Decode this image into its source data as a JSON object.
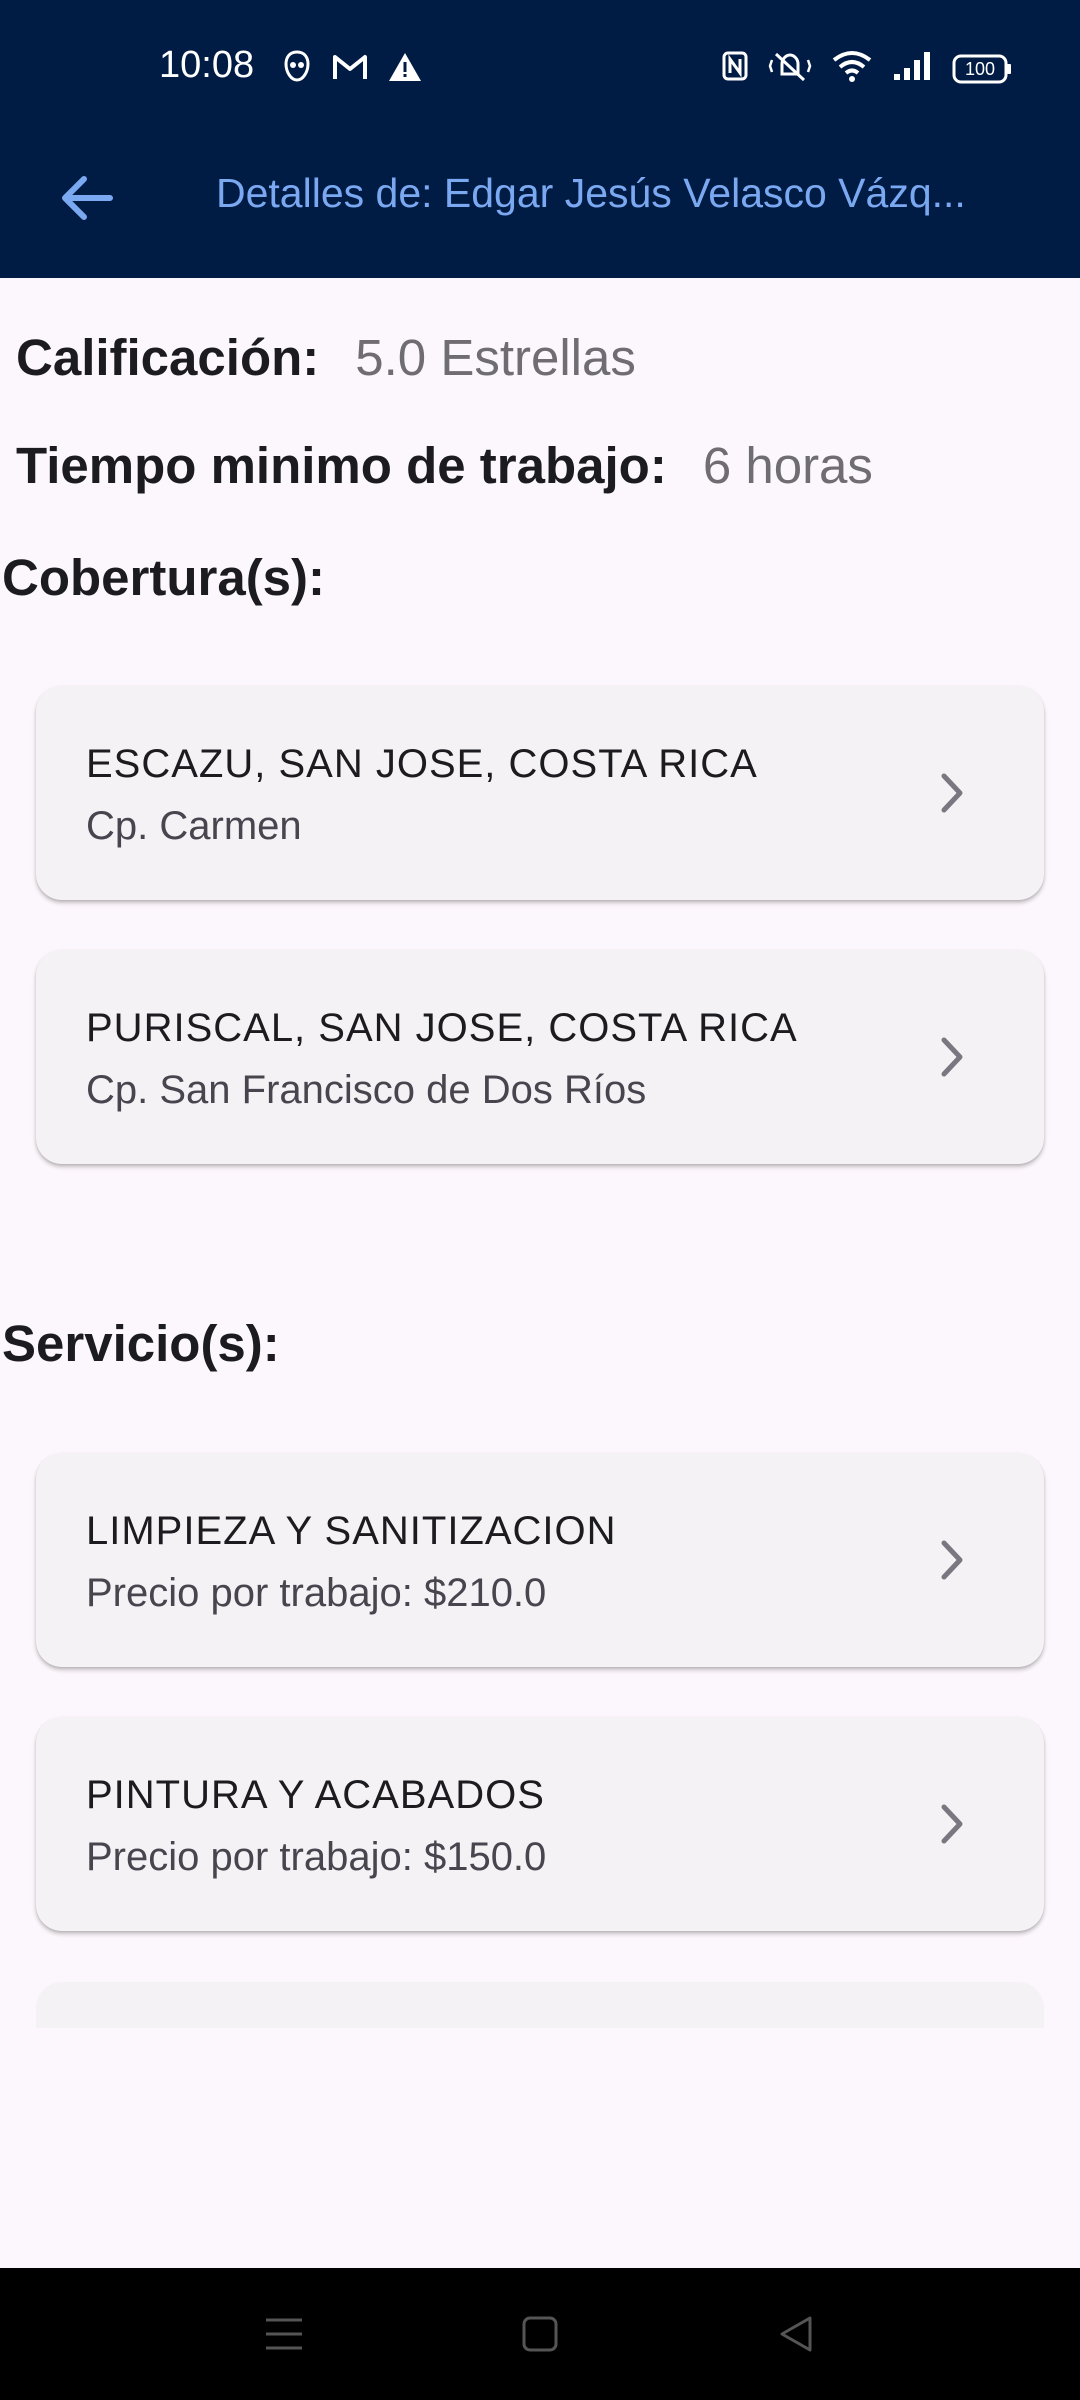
{
  "status_bar": {
    "time": "10:08",
    "left_icons": [
      "app-notification-icon",
      "gmail-icon",
      "warning-icon"
    ],
    "right_icons": [
      "nfc-icon",
      "vibrate-icon",
      "wifi-icon",
      "signal-icon",
      "battery-icon"
    ],
    "battery": "100"
  },
  "app_bar": {
    "title": "Detalles de: Edgar Jesús Velasco Vázq..."
  },
  "rating": {
    "label": "Calificación:",
    "value": "5.0 Estrellas"
  },
  "min_time": {
    "label": "Tiempo minimo de trabajo:",
    "value": "6 horas"
  },
  "coverage": {
    "title": "Cobertura(s):",
    "items": [
      {
        "title": "ESCAZU, SAN JOSE, COSTA RICA",
        "subtitle": "Cp. Carmen"
      },
      {
        "title": "PURISCAL, SAN JOSE, COSTA RICA",
        "subtitle": "Cp. San Francisco de Dos Ríos"
      }
    ]
  },
  "services": {
    "title": "Servicio(s):",
    "items": [
      {
        "title": "LIMPIEZA Y SANITIZACION",
        "subtitle": "Precio por trabajo: $210.0"
      },
      {
        "title": "PINTURA Y ACABADOS",
        "subtitle": "Precio por trabajo: $150.0"
      }
    ]
  },
  "nav_bar": {
    "buttons": [
      "menu-icon",
      "home-icon",
      "back-triangle-icon"
    ]
  },
  "colors": {
    "header_bg": "#001b44",
    "title_color": "#7aa9f2",
    "page_bg": "#fcf7fc",
    "card_bg": "#f5f2f6"
  }
}
